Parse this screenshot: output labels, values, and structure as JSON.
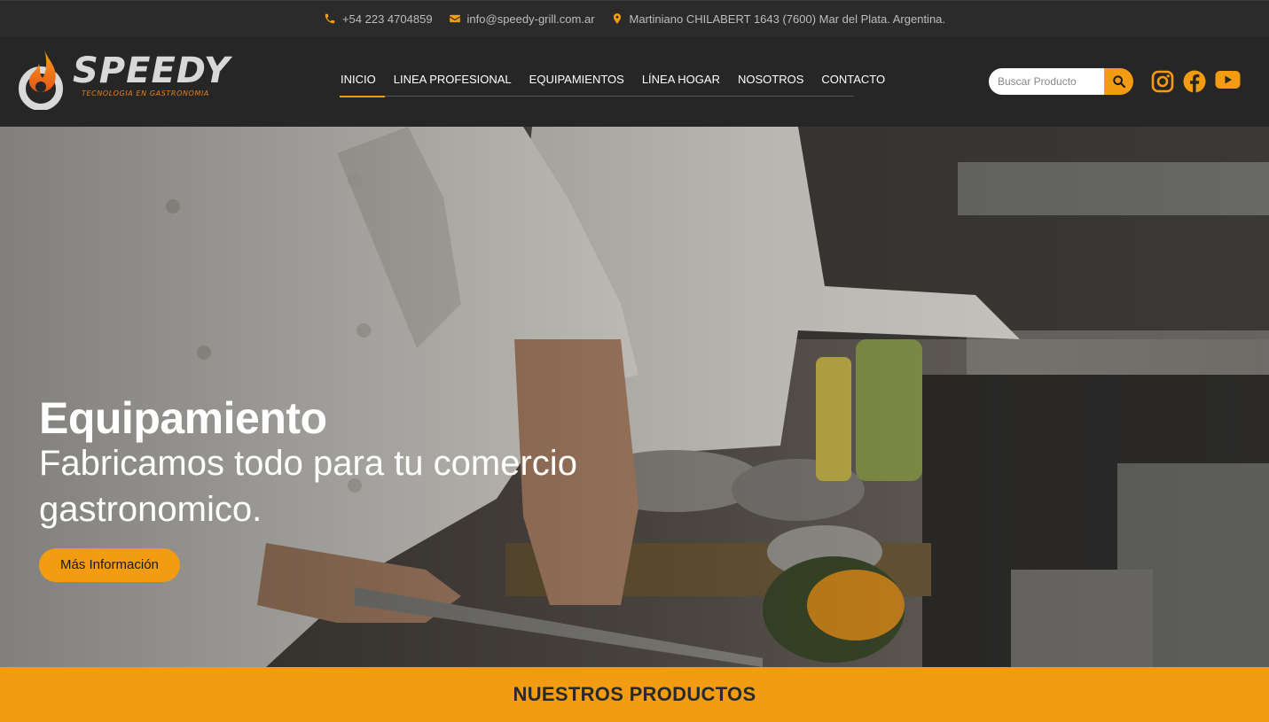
{
  "topbar": {
    "phone": "+54 223 4704859",
    "email": "info@speedy-grill.com.ar",
    "address": "Martiniano CHILABERT 1643 (7600) Mar del Plata. Argentina."
  },
  "logo": {
    "name": "SPEEDY",
    "tagline": "TECNOLOGIA EN GASTRONOMIA"
  },
  "nav": {
    "items": [
      {
        "label": "INICIO",
        "active": true
      },
      {
        "label": "LINEA PROFESIONAL",
        "active": false
      },
      {
        "label": "EQUIPAMIENTOS",
        "active": false
      },
      {
        "label": "LÍNEA HOGAR",
        "active": false
      },
      {
        "label": "NOSOTROS",
        "active": false
      },
      {
        "label": "CONTACTO",
        "active": false
      }
    ]
  },
  "search": {
    "placeholder": "Buscar Producto",
    "value": "",
    "icon": "search-icon"
  },
  "social": [
    "instagram-icon",
    "facebook-icon",
    "youtube-icon"
  ],
  "hero": {
    "title": "Equipamiento",
    "subtitle": "Fabricamos todo para tu comercio gastronomico.",
    "button": "Más Información"
  },
  "products": {
    "heading": "NUESTROS PRODUCTOS"
  },
  "colors": {
    "accent": "#f39c12",
    "header_bg": "#262626",
    "topbar_bg": "#2b2b2b"
  }
}
